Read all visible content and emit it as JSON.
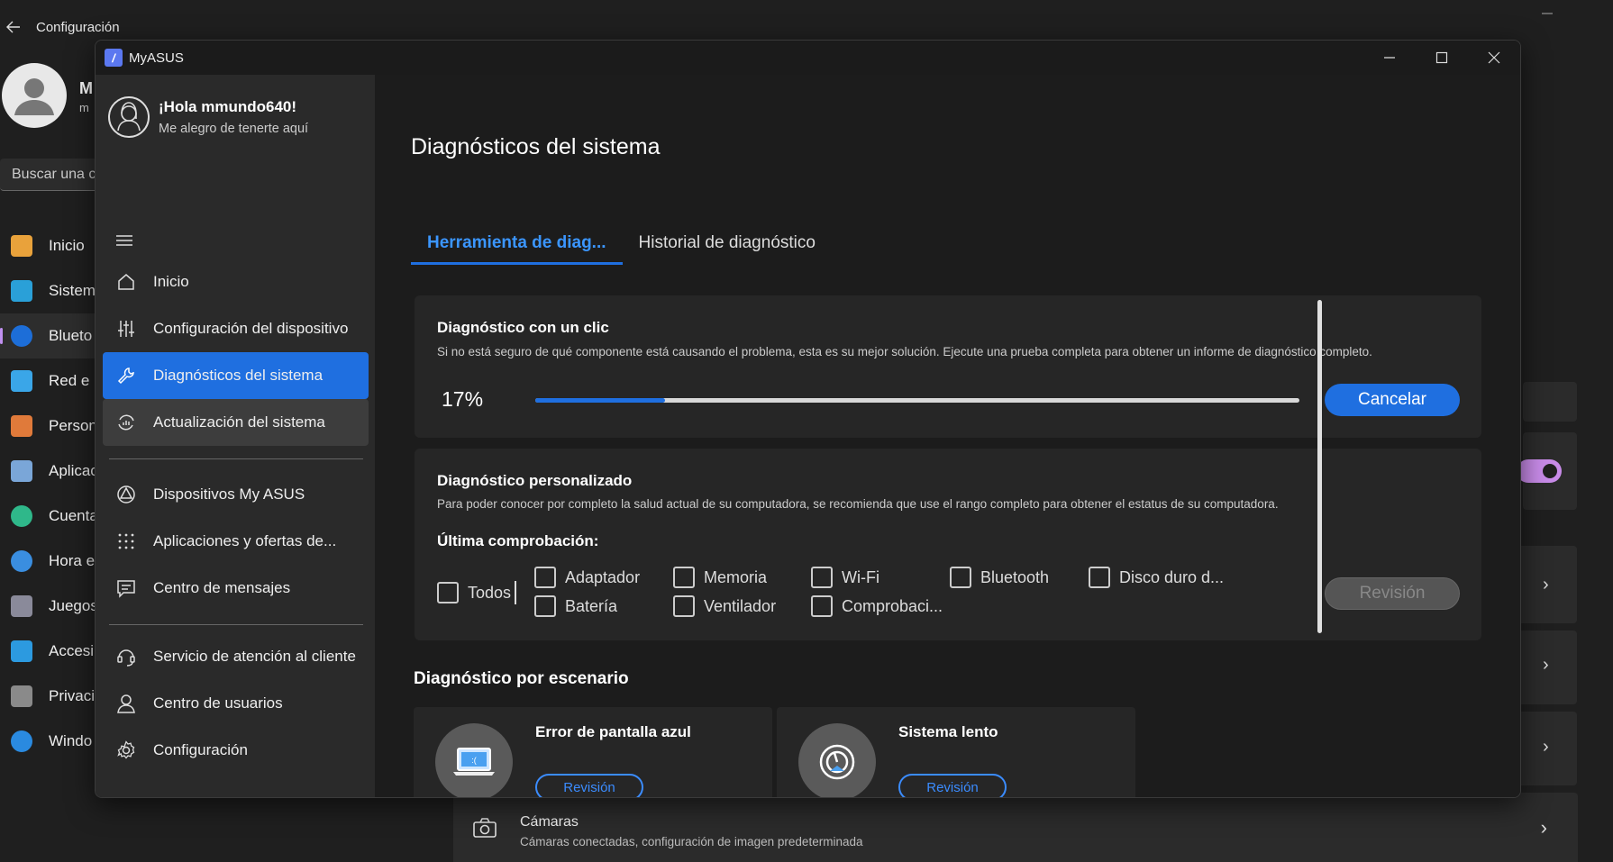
{
  "background_window": {
    "title": "Configuración",
    "user_initial": "M",
    "user_sub": "m",
    "search_placeholder": "Buscar una c",
    "nav": [
      "Inicio",
      "Sistem",
      "Blueto",
      "Red e I",
      "Person",
      "Aplicac",
      "Cuenta",
      "Hora e",
      "Juegos",
      "Accesil",
      "Privaci",
      "Windo"
    ],
    "camera_title": "Cámaras",
    "camera_sub": "Cámaras conectadas, configuración de imagen predeterminada"
  },
  "app": {
    "title": "MyASUS",
    "logo_glyph": "/"
  },
  "sidebar": {
    "greeting": "¡Hola mmundo640!",
    "subgreeting": "Me alegro de tenerte aquí",
    "menu1": [
      {
        "label": "Inicio",
        "icon": "home-icon"
      },
      {
        "label": "Configuración del dispositivo",
        "icon": "sliders-icon"
      },
      {
        "label": "Diagnósticos del sistema",
        "icon": "wrench-icon"
      },
      {
        "label": "Actualización del sistema",
        "icon": "update-icon"
      }
    ],
    "menu2": [
      {
        "label": "Dispositivos My ASUS",
        "icon": "devices-icon"
      },
      {
        "label": "Aplicaciones y ofertas de...",
        "icon": "apps-grid-icon"
      },
      {
        "label": "Centro de mensajes",
        "icon": "message-icon"
      }
    ],
    "menu3": [
      {
        "label": "Servicio de atención al cliente",
        "icon": "headset-icon"
      },
      {
        "label": "Centro de usuarios",
        "icon": "user-icon"
      },
      {
        "label": "Configuración",
        "icon": "gear-icon"
      }
    ]
  },
  "main": {
    "page_title": "Diagnósticos del sistema",
    "tabs": [
      "Herramienta de diag...",
      "Historial de diagnóstico"
    ],
    "one_click": {
      "title": "Diagnóstico con un clic",
      "desc": "Si no está seguro de qué componente está causando el problema, esta es su mejor solución. Ejecute una prueba completa para obtener un informe de diagnóstico completo.",
      "progress_text": "17%",
      "progress": 0.17,
      "cancel_label": "Cancelar"
    },
    "custom": {
      "title": "Diagnóstico personalizado",
      "desc": "Para poder conocer por completo la salud actual de su computadora, se recomienda que use el rango completo para obtener el estatus de su computadora.",
      "last_check": "Última comprobación:",
      "all_label": "Todos",
      "checks_row1": [
        "Adaptador",
        "Memoria",
        "Wi-Fi",
        "Bluetooth",
        "Disco duro d..."
      ],
      "checks_row2": [
        "Batería",
        "Ventilador",
        "Comprobaci..."
      ],
      "review_label": "Revisión"
    },
    "scenario": {
      "title": "Diagnóstico por escenario",
      "items": [
        {
          "title": "Error de pantalla azul",
          "button": "Revisión",
          "icon": "blue-screen-laptop-icon"
        },
        {
          "title": "Sistema lento",
          "button": "Revisión",
          "icon": "slow-system-gauge-icon"
        }
      ]
    }
  },
  "colors": {
    "accent": "#1f6fe0",
    "tab_text": "#3b96ff",
    "background": "#1c1c1c",
    "sidebar": "#2a2a2a"
  }
}
